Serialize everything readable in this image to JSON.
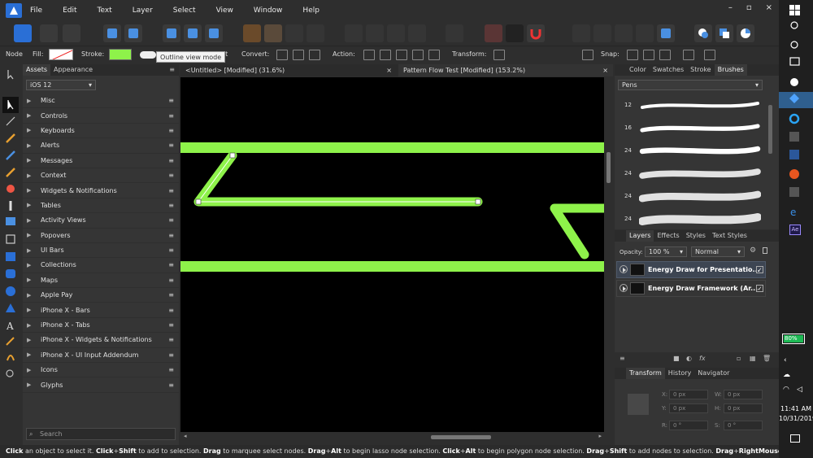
{
  "menu": [
    "File",
    "Edit",
    "Text",
    "Layer",
    "Select",
    "View",
    "Window",
    "Help"
  ],
  "window_controls": [
    "–",
    "▫",
    "×"
  ],
  "context": {
    "node_label": "Node",
    "fill_label": "Fill:",
    "stroke_label": "Stroke:",
    "tooltip": "Outline view mode",
    "tooltip_tail": "pt",
    "convert_label": "Convert:",
    "action_label": "Action:",
    "transform_label": "Transform:",
    "snap_label": "Snap:",
    "stroke_color": "#8ef24a"
  },
  "assets_panel": {
    "tabs": [
      "Assets",
      "Appearance"
    ],
    "set": "iOS 12",
    "categories": [
      "Misc",
      "Controls",
      "Keyboards",
      "Alerts",
      "Messages",
      "Context",
      "Widgets & Notifications",
      "Tables",
      "Activity Views",
      "Popovers",
      "UI Bars",
      "Collections",
      "Maps",
      "Apple Pay",
      "iPhone X - Bars",
      "iPhone X - Tabs",
      "iPhone X - Widgets & Notifications",
      "iPhone X - UI Input Addendum",
      "Icons",
      "Glyphs"
    ],
    "search_placeholder": "Search"
  },
  "documents": {
    "tab1": "<Untitled> [Modified] (31.6%)",
    "tab2": "Pattern Flow Test [Modified] (153.2%)",
    "close": "×"
  },
  "canvas": {
    "background": "#000000",
    "stroke_color": "#8ef24a"
  },
  "brushes_panel": {
    "tabs": [
      "Color",
      "Swatches",
      "Stroke",
      "Brushes"
    ],
    "category": "Pens",
    "sizes": [
      "12",
      "16",
      "24",
      "24",
      "24",
      "24"
    ]
  },
  "layers_panel": {
    "tabs": [
      "Layers",
      "Effects",
      "Styles",
      "Text Styles"
    ],
    "opacity_label": "Opacity:",
    "opacity": "100 %",
    "blend": "Normal",
    "layers": [
      {
        "name": "Energy Draw for Presentatio...",
        "checked": "✓"
      },
      {
        "name": "Energy Draw Framework (Ar...",
        "checked": "✓"
      }
    ]
  },
  "transform_panel": {
    "tabs": [
      "Transform",
      "History",
      "Navigator"
    ],
    "x_label": "X:",
    "y_label": "Y:",
    "w_label": "W:",
    "h_label": "H:",
    "r_label": "R:",
    "s_label": "S:",
    "x": "0 px",
    "y": "0 px",
    "w": "0 px",
    "h": "0 px",
    "r": "0 °",
    "s": "0 °"
  },
  "status": {
    "parts": [
      [
        "b",
        "Click"
      ],
      [
        "t",
        " an object to select it. "
      ],
      [
        "b",
        "Click"
      ],
      [
        "t",
        "+"
      ],
      [
        "b",
        "Shift"
      ],
      [
        "t",
        " to add to selection. "
      ],
      [
        "b",
        "Drag"
      ],
      [
        "t",
        " to marquee select nodes. "
      ],
      [
        "b",
        "Drag"
      ],
      [
        "t",
        "+"
      ],
      [
        "b",
        "Alt"
      ],
      [
        "t",
        " to begin lasso node selection. "
      ],
      [
        "b",
        "Click"
      ],
      [
        "t",
        "+"
      ],
      [
        "b",
        "Alt"
      ],
      [
        "t",
        " to begin polygon node selection. "
      ],
      [
        "b",
        "Drag"
      ],
      [
        "t",
        "+"
      ],
      [
        "b",
        "Shift"
      ],
      [
        "t",
        " to add nodes to selection. "
      ],
      [
        "b",
        "Drag"
      ],
      [
        "t",
        "+"
      ],
      [
        "b",
        "RightMouse"
      ],
      [
        "t",
        " to remov"
      ]
    ]
  },
  "taskbar": {
    "battery": "80%",
    "time": "11:41 AM",
    "date": "10/31/2019",
    "adobe_label": "Ae"
  }
}
